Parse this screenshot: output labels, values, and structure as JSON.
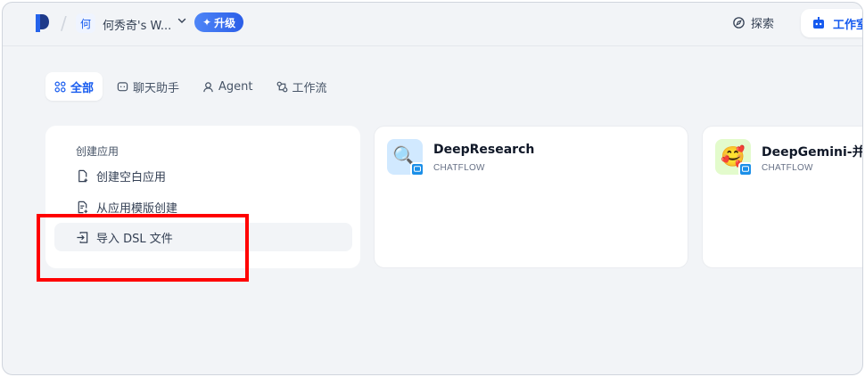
{
  "header": {
    "workspace_avatar": "何",
    "workspace_name": "何秀奇's W...",
    "upgrade_label": "升级",
    "explore_label": "探索",
    "studio_label": "工作室"
  },
  "tabs": [
    {
      "label": "全部",
      "icon": "grid-icon",
      "active": true
    },
    {
      "label": "聊天助手",
      "icon": "chat-icon",
      "active": false
    },
    {
      "label": "Agent",
      "icon": "robot-icon",
      "active": false
    },
    {
      "label": "工作流",
      "icon": "workflow-icon",
      "active": false
    }
  ],
  "create_card": {
    "title": "创建应用",
    "items": [
      {
        "label": "创建空白应用",
        "icon": "new-file-icon"
      },
      {
        "label": "从应用模版创建",
        "icon": "template-icon"
      },
      {
        "label": "导入 DSL 文件",
        "icon": "import-icon"
      }
    ]
  },
  "apps": [
    {
      "name": "DeepResearch",
      "type": "CHATFLOW",
      "icon": "magnifier-emoji",
      "icon_bg": "#d1e9ff"
    },
    {
      "name": "DeepGemini-并行",
      "type": "CHATFLOW",
      "icon": "smiling-face-emoji",
      "icon_bg": "#e3fbcc"
    }
  ],
  "colors": {
    "accent": "#155aef",
    "highlight": "#ff0000"
  }
}
